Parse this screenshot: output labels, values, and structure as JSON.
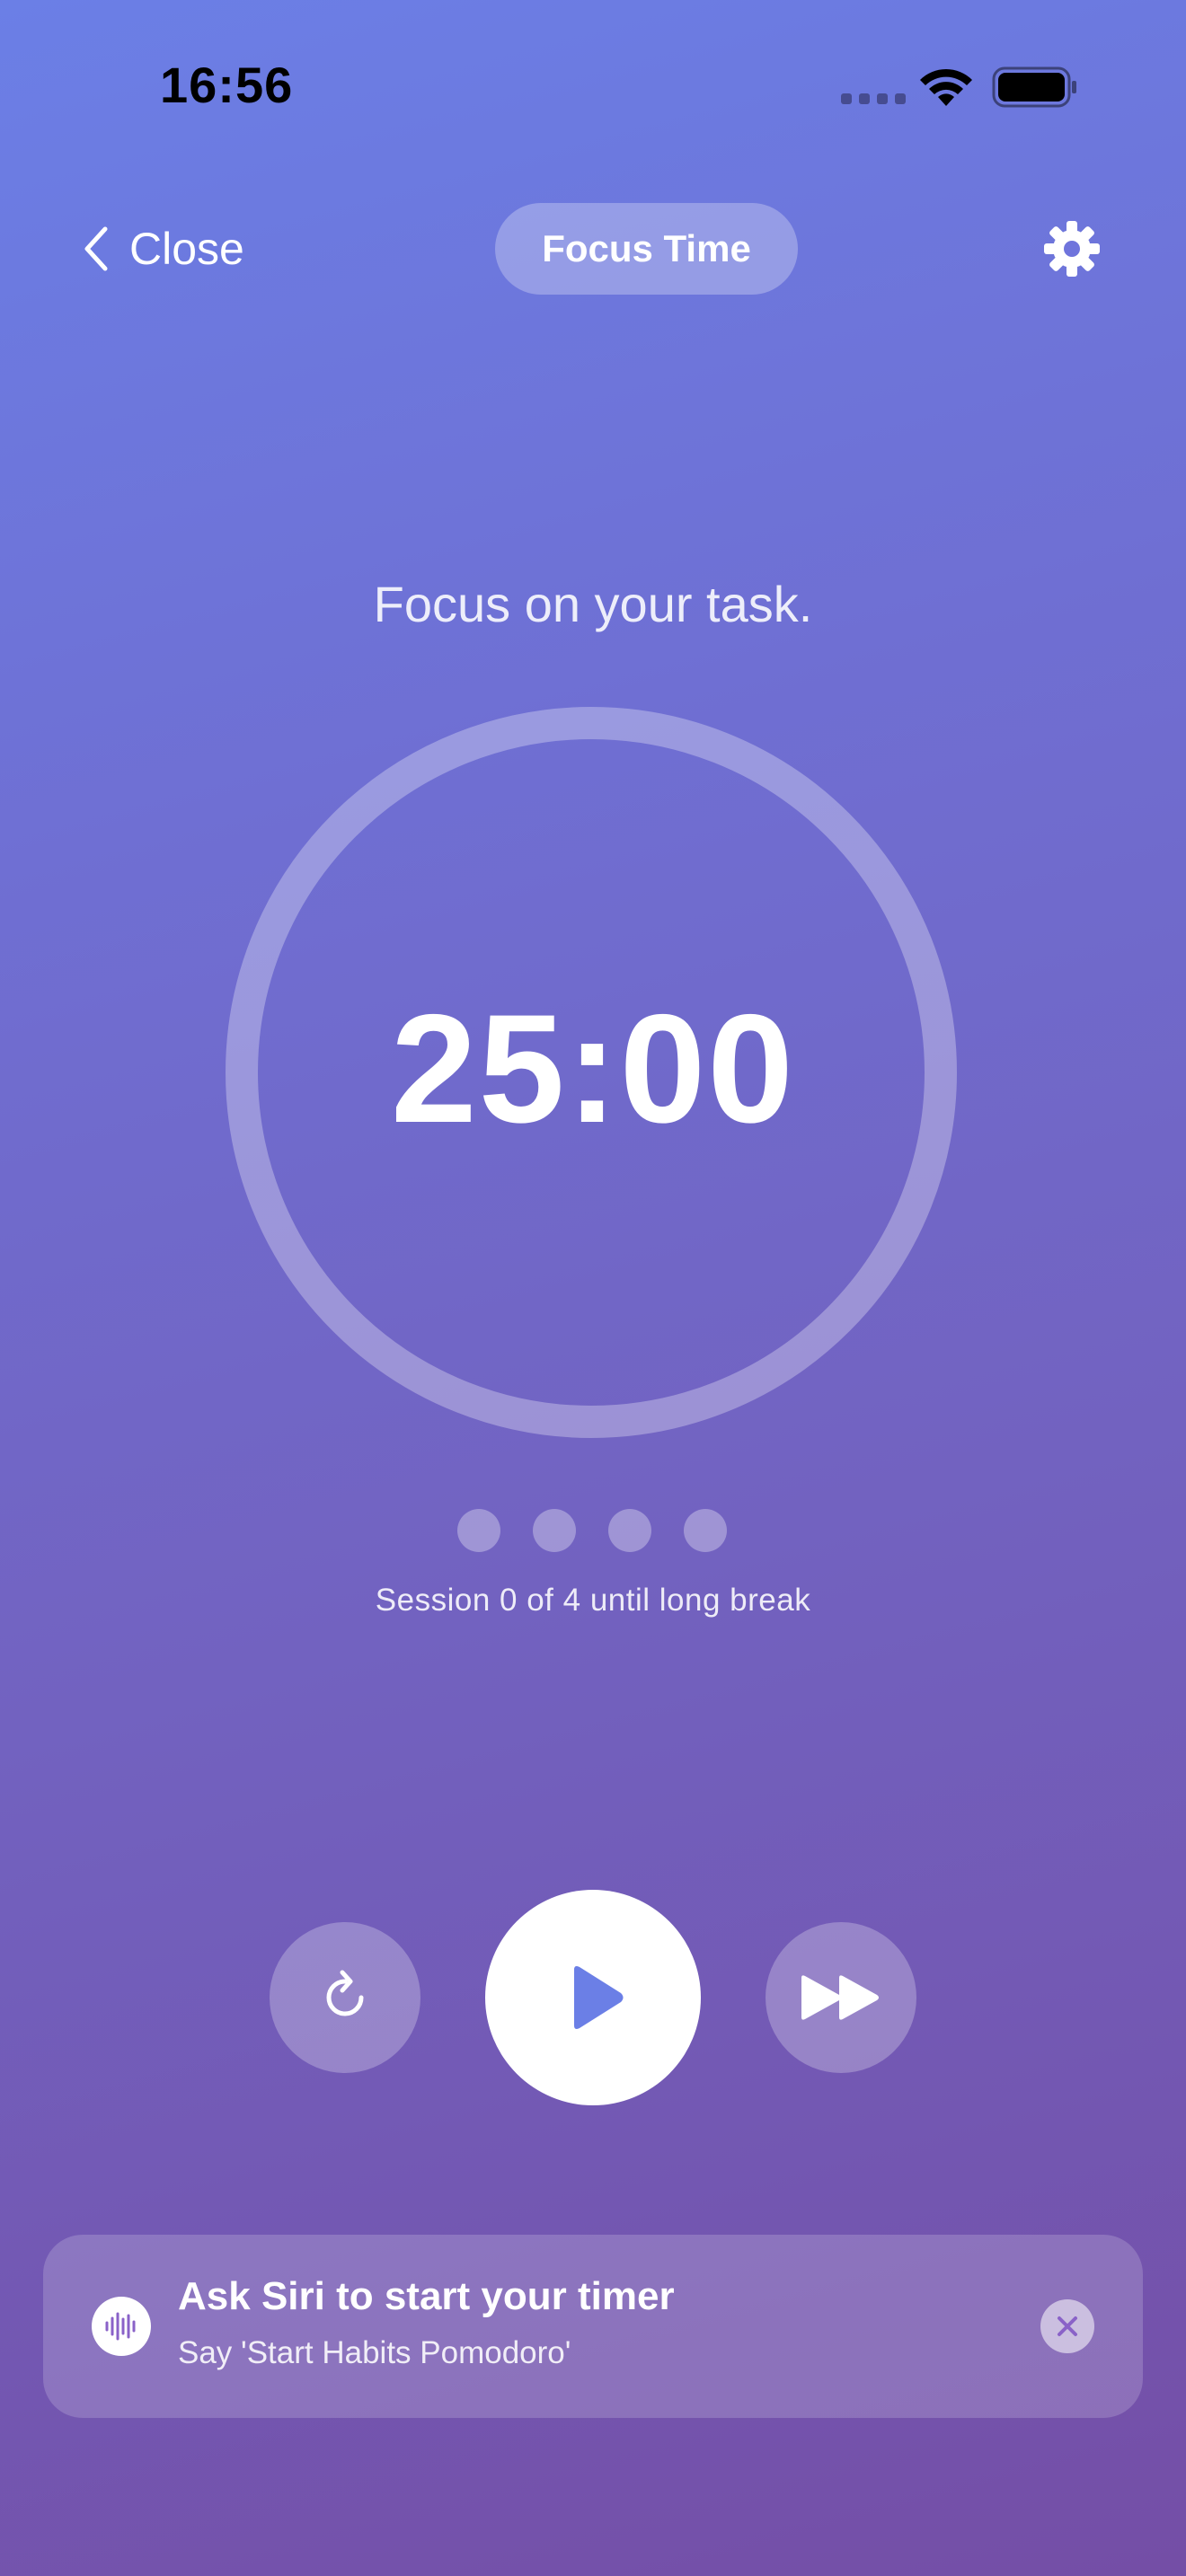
{
  "status_bar": {
    "time": "16:56",
    "icons": [
      "cellular-signal-icon",
      "wifi-icon",
      "battery-icon"
    ]
  },
  "nav": {
    "back_label": "Close",
    "back_icon": "chevron-left-icon",
    "mode_label": "Focus Time",
    "settings_icon": "gear-icon"
  },
  "timer": {
    "prompt": "Focus on your task.",
    "display": "25:00",
    "progress": 0
  },
  "sessions": {
    "completed": 0,
    "total": 4,
    "label": "Session 0 of 4 until long break"
  },
  "controls": {
    "reset_icon": "reset-icon",
    "play_icon": "play-icon",
    "skip_icon": "skip-forward-icon"
  },
  "siri_banner": {
    "icon": "siri-waveform-icon",
    "title": "Ask Siri to start your timer",
    "subtitle": "Say 'Start Habits Pomodoro'",
    "dismiss_icon": "close-icon"
  },
  "colors": {
    "gradient_top": "#6b7fe6",
    "gradient_bottom": "#744ea6",
    "accent": "#6b7fe6",
    "siri_accent": "#8a62c8"
  }
}
